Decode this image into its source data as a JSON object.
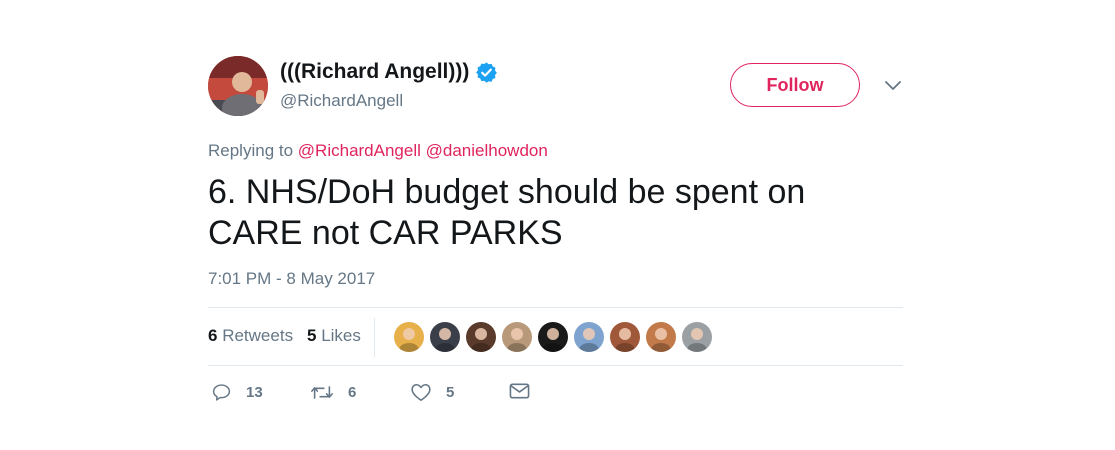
{
  "user": {
    "full_name": "(((Richard Angell)))",
    "handle": "@RichardAngell",
    "verified": true,
    "verified_icon": "verified-badge-icon"
  },
  "follow": {
    "label": "Follow",
    "accent": "#e0245e"
  },
  "menu": {
    "icon": "chevron-down-icon"
  },
  "reply": {
    "prefix": "Replying to",
    "mentions": [
      "@RichardAngell",
      "@danielhowdon"
    ]
  },
  "tweet": {
    "text": "6. NHS/DoH budget should be spent on CARE not CAR PARKS",
    "timestamp": "7:01 PM - 8 May 2017"
  },
  "stats": {
    "retweets_count": "6",
    "retweets_label": "Retweets",
    "likes_count": "5",
    "likes_label": "Likes"
  },
  "likers": [
    {
      "name": "liker-avatar-1",
      "color": "#e8b04a"
    },
    {
      "name": "liker-avatar-2",
      "color": "#3b3f4a"
    },
    {
      "name": "liker-avatar-3",
      "color": "#5a3a2a"
    },
    {
      "name": "liker-avatar-4",
      "color": "#b89a7a"
    },
    {
      "name": "liker-avatar-5",
      "color": "#1a1a1a"
    },
    {
      "name": "liker-avatar-6",
      "color": "#7ea3cf"
    },
    {
      "name": "liker-avatar-7",
      "color": "#a0583a"
    },
    {
      "name": "liker-avatar-8",
      "color": "#c27a4a"
    },
    {
      "name": "liker-avatar-9",
      "color": "#9aa0a4"
    }
  ],
  "actions": {
    "reply_count": "13",
    "retweet_count": "6",
    "like_count": "5"
  },
  "colors": {
    "text": "#14171a",
    "secondary": "#657786",
    "accent": "#e0245e",
    "verified": "#1da1f2",
    "border": "#e1e8ed"
  }
}
